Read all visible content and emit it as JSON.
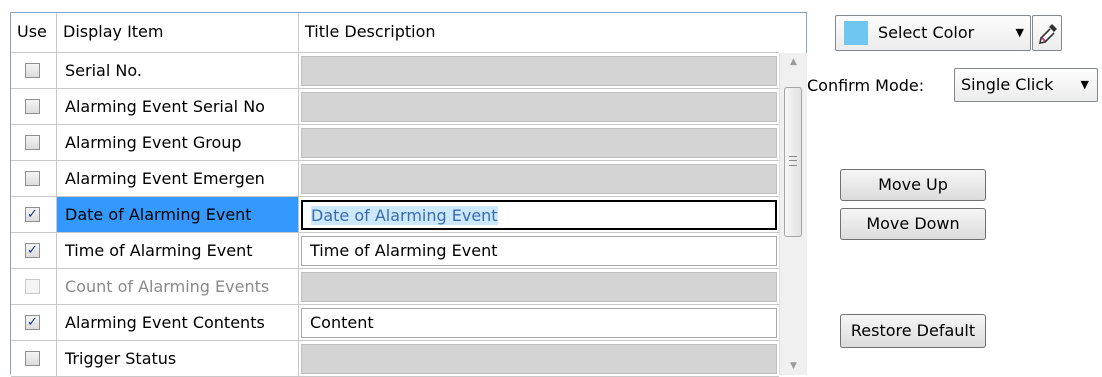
{
  "table": {
    "headers": {
      "use": "Use",
      "display": "Display Item",
      "title": "Title Description"
    },
    "rows": [
      {
        "checked": false,
        "disabled": false,
        "display": "Serial No.",
        "title": "",
        "title_editable": false
      },
      {
        "checked": false,
        "disabled": false,
        "display": "Alarming Event Serial No",
        "title": "",
        "title_editable": false
      },
      {
        "checked": false,
        "disabled": false,
        "display": "Alarming Event Group",
        "title": "",
        "title_editable": false
      },
      {
        "checked": false,
        "disabled": false,
        "display": "Alarming Event Emergen",
        "title": "",
        "title_editable": false
      },
      {
        "checked": true,
        "disabled": false,
        "display": "Date of Alarming Event",
        "title": "Date of Alarming Event",
        "title_editable": true,
        "selected": true
      },
      {
        "checked": true,
        "disabled": false,
        "display": "Time of Alarming Event",
        "title": "Time of Alarming Event",
        "title_editable": true
      },
      {
        "checked": false,
        "disabled": true,
        "display": "Count of Alarming Events",
        "title": "",
        "title_editable": false
      },
      {
        "checked": true,
        "disabled": false,
        "display": "Alarming Event Contents",
        "title": "Content",
        "title_editable": true
      },
      {
        "checked": false,
        "disabled": false,
        "display": "Trigger Status",
        "title": "",
        "title_editable": false
      }
    ]
  },
  "color_select": {
    "label": "Select Color",
    "swatch_color": "#6ec6f1"
  },
  "confirm_mode": {
    "label": "Confirm Mode:",
    "value": "Single Click"
  },
  "buttons": {
    "move_up": "Move Up",
    "move_down": "Move Down",
    "restore_default": "Restore Default"
  },
  "colors": {
    "selection": "#3399ff",
    "disabled_cell": "#d4d4d4"
  }
}
